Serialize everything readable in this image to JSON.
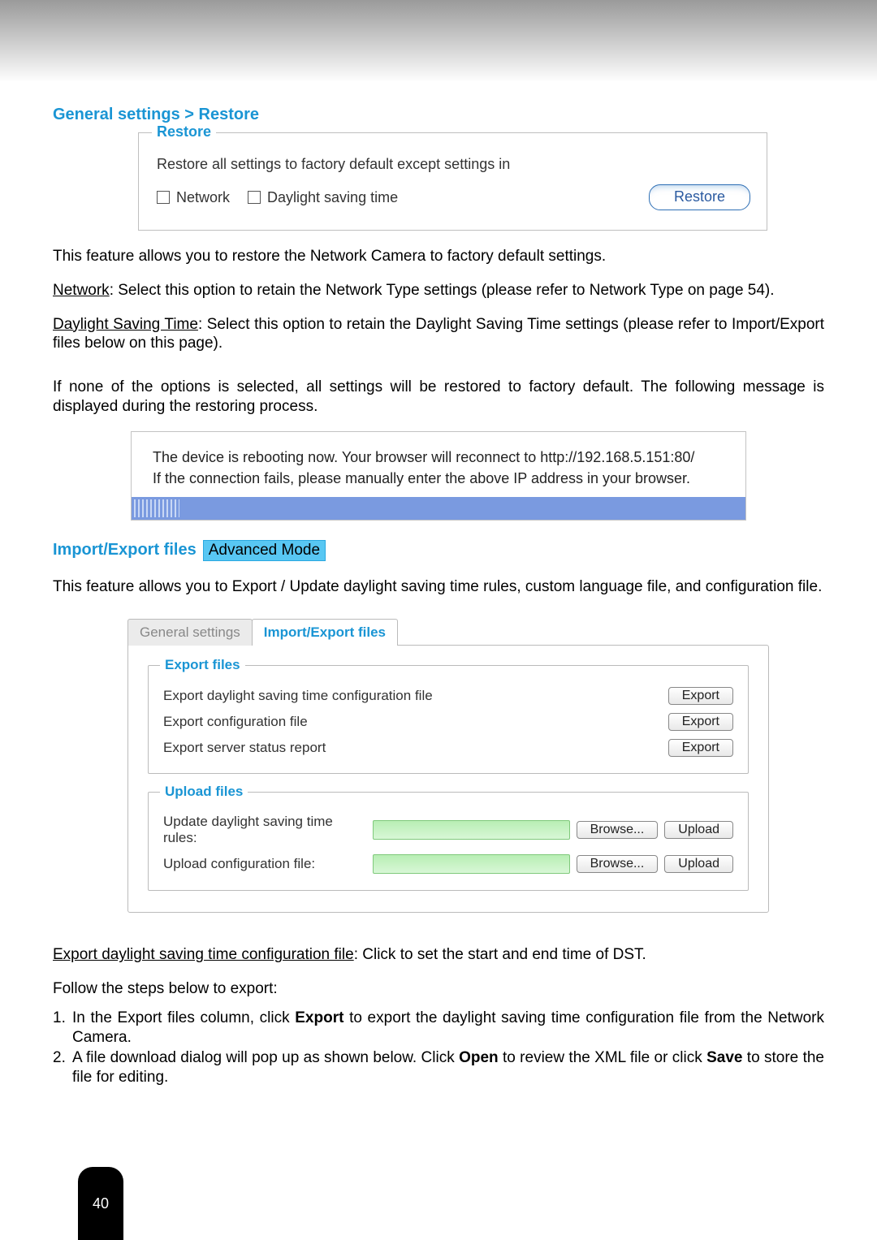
{
  "section1_title": "General settings > Restore",
  "restore_box": {
    "legend": "Restore",
    "description": "Restore all settings to factory default except settings in",
    "network_label": "Network",
    "dst_label": "Daylight saving time",
    "button": "Restore"
  },
  "para1": "This feature allows you to restore the Network Camera to factory default settings.",
  "para2_u": "Network",
  "para2_rest": ": Select this option to retain the Network Type settings (please refer to Network Type on page 54).",
  "para3_u": "Daylight Saving Time",
  "para3_rest": ": Select this option to retain the Daylight Saving Time settings (please refer to Import/Export files below on this page).",
  "para4": "If none of the options is selected, all settings will be restored to factory default.  The following message is displayed during the restoring process.",
  "reboot_line1": "The device is rebooting now. Your browser will reconnect to http://192.168.5.151:80/",
  "reboot_line2": "If the connection fails, please manually enter the above IP address in your browser.",
  "section2_title": "Import/Export files",
  "badge": "Advanced Mode",
  "para5": "This feature allows you to Export / Update daylight saving time rules, custom language file, and configuration file.",
  "tabs": {
    "general": "General settings",
    "import_export": "Import/Export files"
  },
  "export_field": {
    "legend": "Export files",
    "row1": "Export daylight saving time configuration file",
    "row2": "Export configuration file",
    "row3": "Export server status report",
    "btn": "Export"
  },
  "upload_field": {
    "legend": "Upload files",
    "row1": "Update daylight saving time rules:",
    "row2": "Upload configuration file:",
    "browse": "Browse...",
    "upload": "Upload"
  },
  "para6_u": "Export daylight saving time configuration file",
  "para6_rest": ": Click to set the start and end time of DST.",
  "steps_intro": "Follow the steps below to export:",
  "step1_pre": "In the Export files column, click ",
  "step1_bold": "Export",
  "step1_post": " to export the daylight saving time configuration file from the Network Camera.",
  "step2_pre": "A file download dialog will pop up as shown below. Click ",
  "step2_b1": "Open",
  "step2_mid": " to review the XML file or click ",
  "step2_b2": "Save",
  "step2_post": " to store the file for editing.",
  "page_number": "40"
}
